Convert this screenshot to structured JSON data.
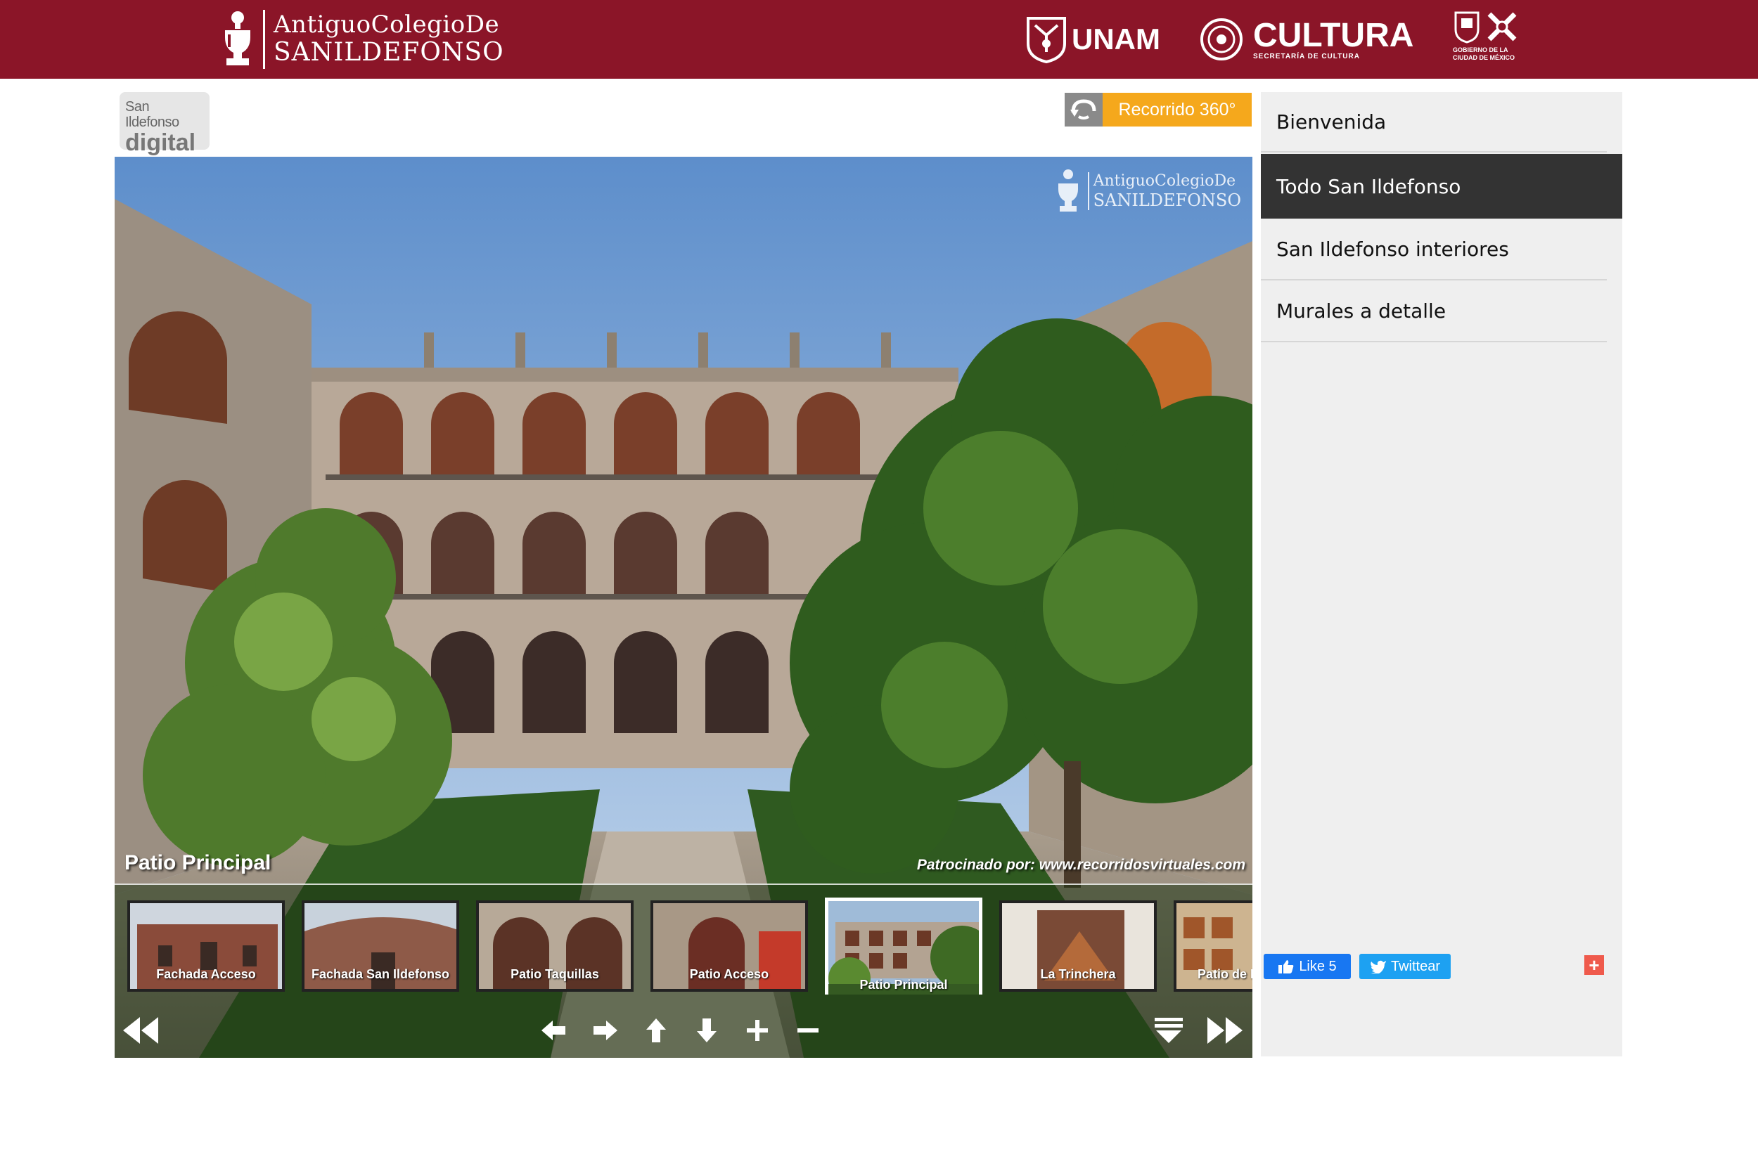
{
  "header": {
    "site_logo": {
      "line1": "AntiguoColegioDe",
      "line2": "SANILDEFONSO"
    },
    "partners": {
      "unam": "UNAM",
      "cultura": "CULTURA",
      "cultura_sub": "SECRETARÍA DE CULTURA",
      "cdmx_line1": "GOBIERNO DE LA",
      "cdmx_line2": "CIUDAD DE MÉXICO"
    },
    "bg_color": "#8b1528"
  },
  "badge": {
    "small": "San Ildefonso",
    "big": "digital"
  },
  "tour_button": {
    "label": "Recorrido 360°",
    "icon": "rotate-360-icon",
    "color": "#f5a81c"
  },
  "viewer": {
    "watermark": {
      "line1": "AntiguoColegioDe",
      "line2": "SANILDEFONSO"
    },
    "scene_title": "Patio Principal",
    "sponsor": "Patrocinado por: www.recorridosvirtuales.com",
    "thumbnails": [
      {
        "label": "Fachada Acceso",
        "active": false
      },
      {
        "label": "Fachada San Ildefonso",
        "active": false
      },
      {
        "label": "Patio Taquillas",
        "active": false
      },
      {
        "label": "Patio Acceso",
        "active": false
      },
      {
        "label": "Patio Principal",
        "active": true
      },
      {
        "label": "La Trinchera",
        "active": false
      },
      {
        "label": "Patio de I",
        "active": false
      }
    ],
    "controls": [
      "rewind-icon",
      "arrow-left-icon",
      "arrow-right-icon",
      "arrow-up-icon",
      "arrow-down-icon",
      "zoom-in-icon",
      "zoom-out-icon",
      "collapse-thumbs-icon",
      "fast-forward-icon"
    ]
  },
  "sidebar": {
    "items": [
      {
        "label": "Bienvenida",
        "active": false
      },
      {
        "label": "Todo San Ildefonso",
        "active": true
      },
      {
        "label": "San Ildefonso interiores",
        "active": false
      },
      {
        "label": "Murales a detalle",
        "active": false
      }
    ],
    "social": {
      "facebook": "Like 5",
      "twitter": "Twittear",
      "share": "+"
    }
  }
}
